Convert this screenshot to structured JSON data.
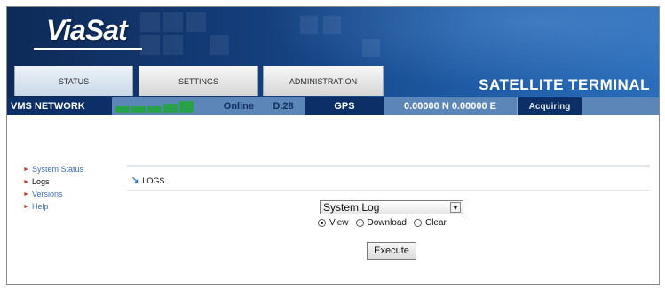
{
  "brand": {
    "logo": "ViaSat"
  },
  "tabs": [
    {
      "label": "STATUS",
      "active": true
    },
    {
      "label": "SETTINGS",
      "active": false
    },
    {
      "label": "ADMINISTRATION",
      "active": false
    }
  ],
  "header": {
    "title": "SATELLITE TERMINAL"
  },
  "status_bar": {
    "network": "VMS NETWORK",
    "signal_bars": 5,
    "state": "Online",
    "code": "D.28",
    "gps_label": "GPS",
    "coordinates": "0.00000 N 0.00000 E",
    "gps_status": "Acquiring"
  },
  "colors": {
    "navy": "#0b2f66",
    "steel_blue": "#5d86b8",
    "signal_green": "#29a04a",
    "link_blue": "#3a6fb5",
    "bullet_red": "#c0392b"
  },
  "sidebar": {
    "items": [
      {
        "label": "System Status",
        "active": false
      },
      {
        "label": "Logs",
        "active": true
      },
      {
        "label": "Versions",
        "active": false
      },
      {
        "label": "Help",
        "active": false
      }
    ]
  },
  "main": {
    "section_title": "LOGS",
    "log_select": {
      "value": "System Log"
    },
    "options": [
      {
        "label": "View",
        "selected": true
      },
      {
        "label": "Download",
        "selected": false
      },
      {
        "label": "Clear",
        "selected": false
      }
    ],
    "execute_label": "Execute"
  }
}
